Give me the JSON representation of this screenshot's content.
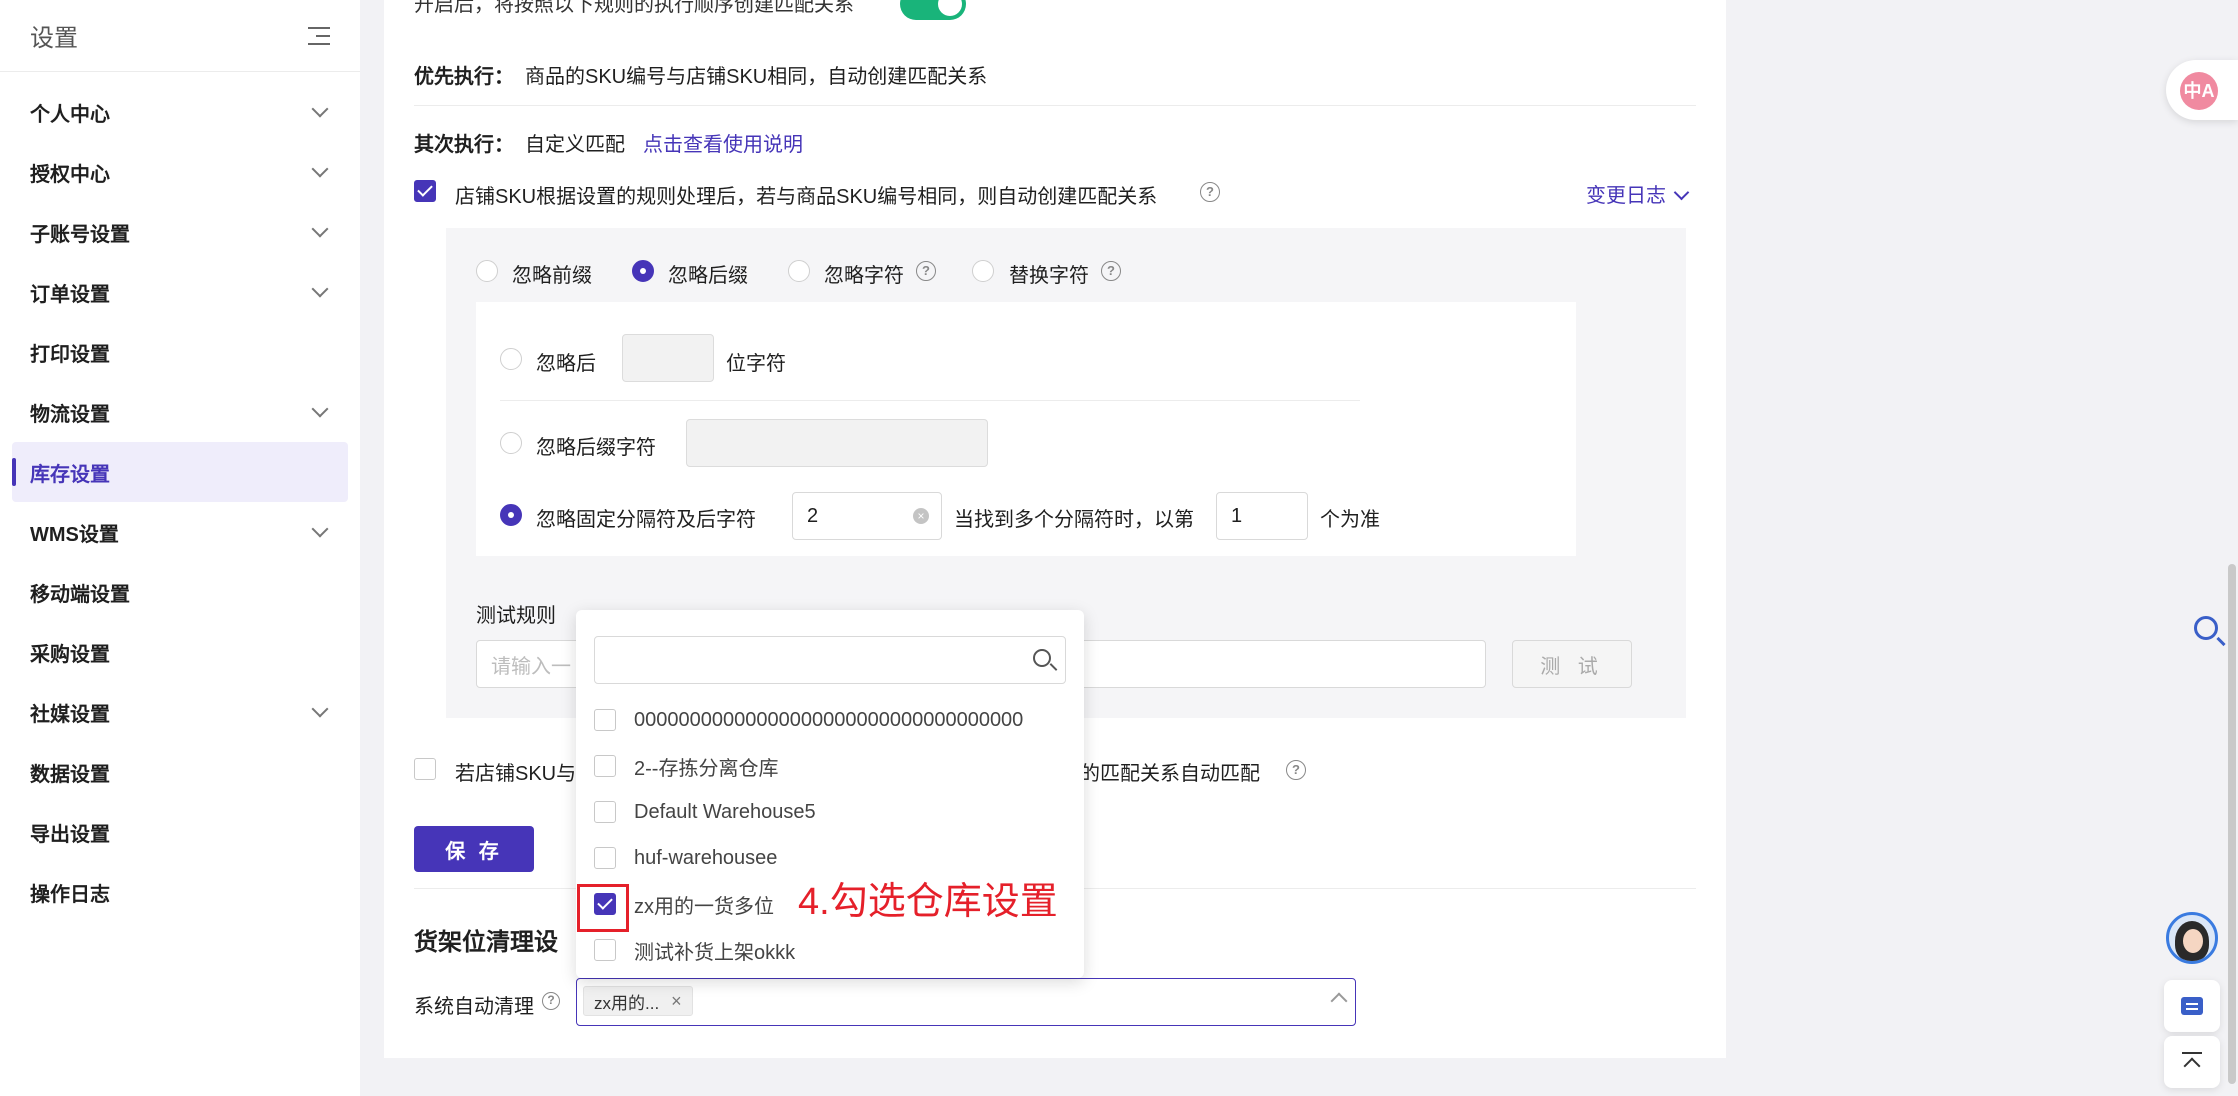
{
  "sidebar": {
    "title": "设置",
    "items": [
      {
        "label": "个人中心",
        "expandable": true
      },
      {
        "label": "授权中心",
        "expandable": true
      },
      {
        "label": "子账号设置",
        "expandable": true
      },
      {
        "label": "订单设置",
        "expandable": true
      },
      {
        "label": "打印设置",
        "expandable": false
      },
      {
        "label": "物流设置",
        "expandable": true
      },
      {
        "label": "库存设置",
        "expandable": false,
        "active": true
      },
      {
        "label": "WMS设置",
        "expandable": true
      },
      {
        "label": "移动端设置",
        "expandable": false
      },
      {
        "label": "采购设置",
        "expandable": false
      },
      {
        "label": "社媒设置",
        "expandable": true
      },
      {
        "label": "数据设置",
        "expandable": false
      },
      {
        "label": "导出设置",
        "expandable": false
      },
      {
        "label": "操作日志",
        "expandable": false
      }
    ]
  },
  "main": {
    "top_cut_text": "开启后，将按照以下规则的执行顺序创建匹配关系",
    "toggle_on": true,
    "priority": {
      "label": "优先执行：",
      "text": "商品的SKU编号与店铺SKU相同，自动创建匹配关系"
    },
    "secondary": {
      "label": "其次执行：",
      "text": "自定义匹配",
      "link": "点击查看使用说明"
    },
    "rule_checkbox": {
      "checked": true,
      "text": "店铺SKU根据设置的规则处理后，若与商品SKU编号相同，则自动创建匹配关系"
    },
    "change_log": "变更日志",
    "mode_options": [
      {
        "label": "忽略前缀",
        "selected": false,
        "help": false
      },
      {
        "label": "忽略后缀",
        "selected": true,
        "help": false
      },
      {
        "label": "忽略字符",
        "selected": false,
        "help": true
      },
      {
        "label": "替换字符",
        "selected": false,
        "help": true
      }
    ],
    "suffix": {
      "opt1_label": "忽略后",
      "opt1_unit": "位字符",
      "opt2_label": "忽略后缀字符",
      "opt3_label": "忽略固定分隔符及后字符",
      "opt3_value": "2",
      "opt3_mid": "当找到多个分隔符时，以第",
      "opt3_index": "1",
      "opt3_end": "个为准"
    },
    "test": {
      "label": "测试规则",
      "placeholder": "请输入一",
      "button": "测 试"
    },
    "second_checkbox": {
      "checked": false,
      "text_left": "若店铺SKU与",
      "text_right": "的匹配关系自动匹配"
    },
    "save_button": "保 存",
    "shelf_section_title": "货架位清理设",
    "auto_clean_label": "系统自动清理",
    "selected_tag": "zx用的...",
    "dropdown": {
      "options": [
        {
          "label": "00000000000000000000000000000000000",
          "checked": false
        },
        {
          "label": "2--存拣分离仓库",
          "checked": false
        },
        {
          "label": "Default Warehouse5",
          "checked": false
        },
        {
          "label": "huf-warehousee",
          "checked": false
        },
        {
          "label": "zx用的一货多位",
          "checked": true
        },
        {
          "label": "测试补货上架okkk",
          "checked": false
        }
      ]
    }
  },
  "annotation": {
    "text": "4.勾选仓库设置",
    "color": "#e5202a"
  },
  "floating": {
    "translate_icon": "中A"
  },
  "colors": {
    "accent": "#4635b8",
    "toggle": "#19b47a"
  }
}
